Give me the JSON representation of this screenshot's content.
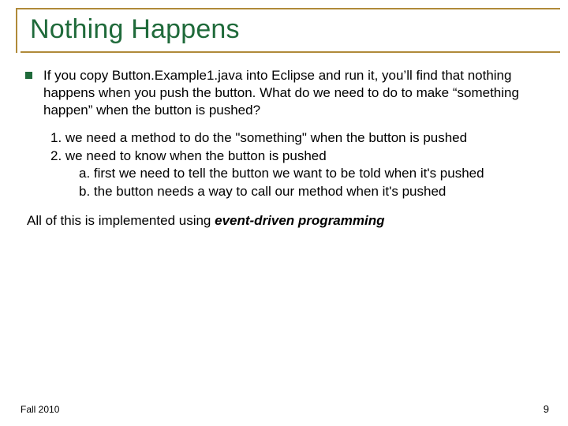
{
  "title": "Nothing Happens",
  "bullet": "If you copy Button.Example1.java into Eclipse and run it, you’ll find that nothing happens when you push the button. What do we need to do to make “something happen” when the button is pushed?",
  "lines": {
    "l1": "1. we need a method to do the \"something\" when the button is pushed",
    "l2": "2. we need to know when the button is pushed",
    "l2a": "a. first we need to tell the button we want to be told when it's pushed",
    "l2b": "b. the button needs a way to call our method when it's pushed"
  },
  "closing_prefix": "All of this is implemented using ",
  "closing_em": "event-driven programming",
  "footer": {
    "left": "Fall 2010",
    "right": "9"
  }
}
